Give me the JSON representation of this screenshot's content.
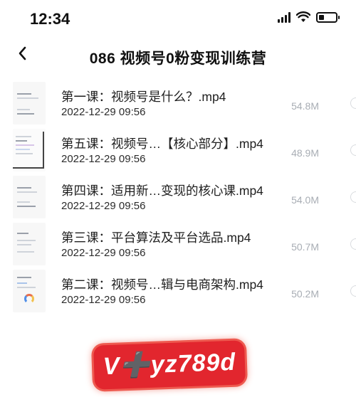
{
  "status_bar": {
    "time": "12:34",
    "icons": [
      "cellular-signal-icon",
      "wifi-icon",
      "battery-icon"
    ],
    "battery_level": 0.3
  },
  "nav": {
    "back_icon": "chevron-left-icon",
    "title": "086 视频号0粉变现训练营"
  },
  "files": [
    {
      "name": "第一课：视频号是什么？.mp4",
      "date": "2022-12-29 09:56",
      "size": "54.8M"
    },
    {
      "name": "第五课：视频号…【核心部分】.mp4",
      "date": "2022-12-29 09:56",
      "size": "48.9M"
    },
    {
      "name": "第四课：适用新…变现的核心课.mp4",
      "date": "2022-12-29 09:56",
      "size": "54.0M"
    },
    {
      "name": "第三课：平台算法及平台选品.mp4",
      "date": "2022-12-29 09:56",
      "size": "50.7M"
    },
    {
      "name": "第二课：视频号…辑与电商架构.mp4",
      "date": "2022-12-29 09:56",
      "size": "50.2M"
    }
  ],
  "watermark": {
    "text": "V➕yz789d"
  },
  "colors": {
    "watermark_red": "#e2262e",
    "size_gray": "#a8adb4"
  }
}
